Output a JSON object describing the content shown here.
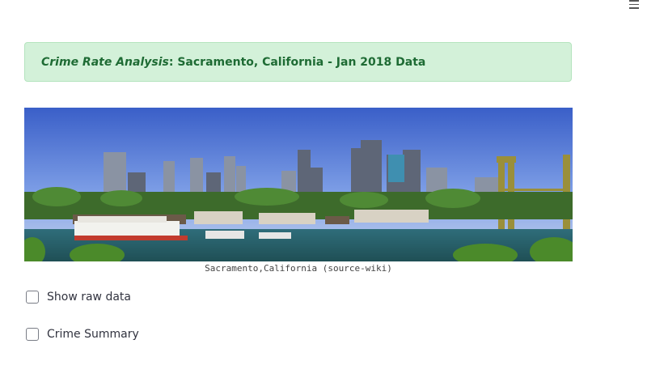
{
  "header": {
    "menu_icon": "hamburger-menu-icon"
  },
  "banner": {
    "title_italic": "Crime Rate Analysis",
    "title_rest": ": Sacramento, California - Jan 2018 Data",
    "bg_color": "#d3f1d9",
    "text_color": "#1e6b34"
  },
  "hero_image": {
    "subject": "Sacramento skyline panorama with Tower Bridge and river",
    "caption": "Sacramento,California (source-wiki)"
  },
  "controls": {
    "show_raw_data": {
      "label": "Show raw data",
      "checked": false
    },
    "crime_summary": {
      "label": "Crime Summary",
      "checked": false
    }
  }
}
